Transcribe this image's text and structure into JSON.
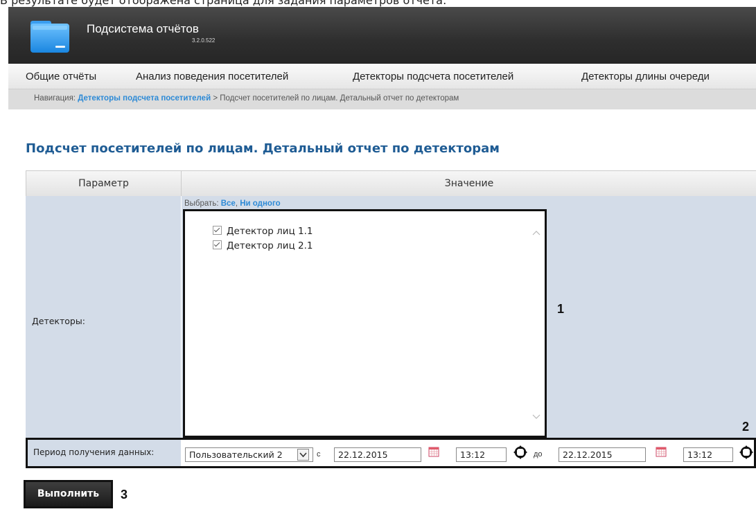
{
  "intro_text": "В результате будет отображена страница для задания параметров отчета:",
  "header": {
    "title": "Подсистема отчётов",
    "version": "3.2.0.522"
  },
  "menu": {
    "items": [
      {
        "label": "Общие отчёты"
      },
      {
        "label": "Анализ поведения посетителей"
      },
      {
        "label": "Детекторы подсчета посетителей"
      },
      {
        "label": "Детекторы длины очереди"
      }
    ]
  },
  "breadcrumb": {
    "prefix": "Навигация:",
    "link": "Детекторы подсчета посетителей",
    "separator": ">",
    "current": "Подсчет посетителей по лицам. Детальный отчет по детекторам"
  },
  "report": {
    "title": "Подсчет посетителей по лицам. Детальный отчет по детекторам",
    "col_param": "Параметр",
    "col_value": "Значение",
    "detectors_label": "Детекторы:",
    "select_prefix": "Выбрать:",
    "select_all": "Все",
    "select_sep": ",",
    "select_none": "Ни одного",
    "detectors": [
      {
        "name": "Детектор лиц 1.1",
        "checked": true
      },
      {
        "name": "Детектор лиц 2.1",
        "checked": true
      }
    ],
    "period_label": "Период получения данных:",
    "period_value": "Пользовательский 2",
    "from_label": "с",
    "from_date": "22.12.2015",
    "from_time": "13:12",
    "to_label": "до",
    "to_date": "22.12.2015",
    "to_time": "13:12"
  },
  "callouts": [
    "1",
    "2",
    "3"
  ],
  "run_button": "Выполнить",
  "colors": {
    "header_bg": "#2e2e2e",
    "title_blue": "#1f5c94",
    "link_blue": "#2d8ad6",
    "row_bg": "#d3dce8"
  }
}
